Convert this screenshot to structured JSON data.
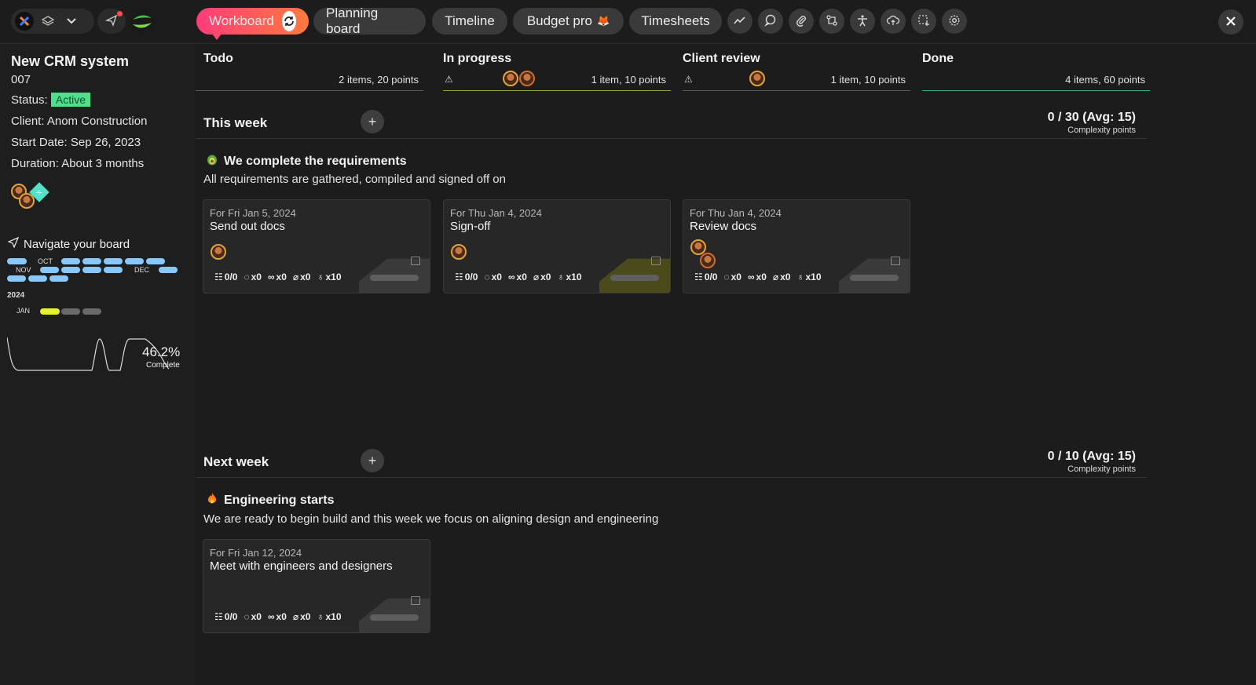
{
  "colors": {
    "accent": "#ff3b7a",
    "status_active": "#4ee08a",
    "timeline_bar": "#86c8ff",
    "timeline_current": "#e6f51b"
  },
  "topbar": {
    "tabs": [
      {
        "label": "Workboard",
        "active": true,
        "badge_icon": "sync-icon"
      },
      {
        "label": "Planning board"
      },
      {
        "label": "Timeline"
      },
      {
        "label": "Budget pro",
        "badge_icon": "fox-icon"
      },
      {
        "label": "Timesheets"
      }
    ],
    "tools": [
      "trend-icon",
      "comment-icon",
      "attachment-icon",
      "git-compare-icon",
      "accessibility-icon",
      "upload-cloud-icon",
      "selection-icon",
      "settings-icon"
    ]
  },
  "project": {
    "title": "New CRM system",
    "code": "007",
    "status_label": "Status:",
    "status_value": "Active",
    "client": "Client: Anom Construction",
    "start_date": "Start Date: Sep 26, 2023",
    "duration": "Duration: About 3 months"
  },
  "navigator": {
    "title": "Navigate your board",
    "months": {
      "oct": "OCT",
      "nov": "NOV",
      "dec": "DEC",
      "jan": "JAN"
    },
    "year": "2024",
    "percent": "46.2%",
    "percent_label": "Complete"
  },
  "columns": [
    {
      "title": "Todo",
      "meta": "2 items, 20 points"
    },
    {
      "title": "In progress",
      "meta": "1 item, 10 points",
      "warning": "⚠"
    },
    {
      "title": "Client review",
      "meta": "1 item, 10 points",
      "warning": "⚠"
    },
    {
      "title": "Done",
      "meta": "4 items, 60 points"
    }
  ],
  "sections": [
    {
      "title": "This week",
      "points": "0 / 30 (Avg: 15)",
      "points_label": "Complexity points",
      "goal": "We complete the requirements",
      "goal_desc": "All requirements are gathered, compiled and signed off on",
      "cards": [
        {
          "date": "For Fri Jan 5, 2024",
          "title": "Send out docs",
          "checklist": "0/0",
          "comments": "x0",
          "links": "x0",
          "attachments": "x0",
          "points": "x10"
        },
        {
          "date": "For Thu Jan 4, 2024",
          "title": "Sign-off",
          "checklist": "0/0",
          "comments": "x0",
          "links": "x0",
          "attachments": "x0",
          "points": "x10"
        },
        {
          "date": "For Thu Jan 4, 2024",
          "title": "Review docs",
          "checklist": "0/0",
          "comments": "x0",
          "links": "x0",
          "attachments": "x0",
          "points": "x10"
        }
      ]
    },
    {
      "title": "Next week",
      "points": "0 / 10 (Avg: 15)",
      "points_label": "Complexity points",
      "goal": "Engineering starts",
      "goal_desc": "We are ready to begin build and this week we focus on aligning design and engineering",
      "cards": [
        {
          "date": "For Fri Jan 12, 2024",
          "title": "Meet with engineers and designers",
          "checklist": "0/0",
          "comments": "x0",
          "links": "x0",
          "attachments": "x0",
          "points": "x10"
        }
      ]
    }
  ]
}
